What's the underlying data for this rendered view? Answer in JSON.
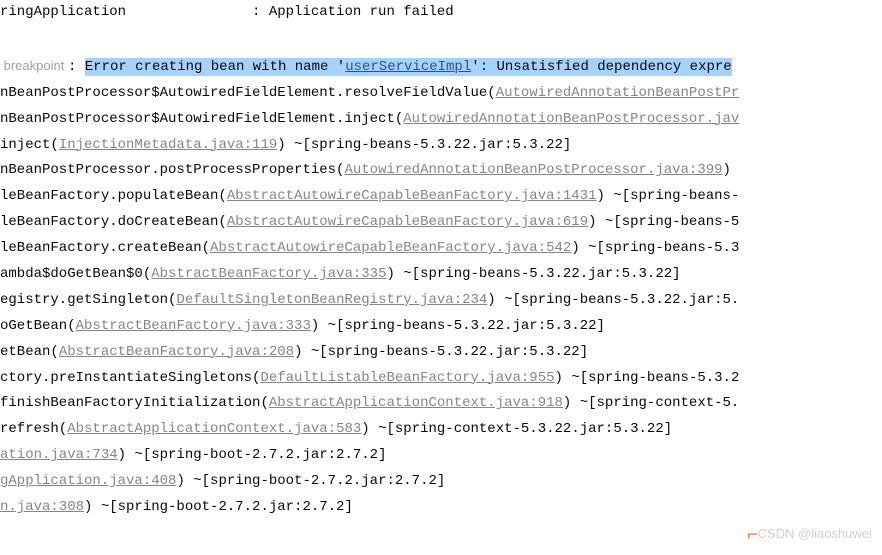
{
  "lines": {
    "l0": {
      "prefix": "ringApplication               : ",
      "msg": "Application run failed"
    },
    "breakpoint": {
      "label": " breakpoint ",
      "sep": ": ",
      "hl_before": "Error creating bean with name '",
      "bean": "userServiceImpl",
      "hl_after": "': Unsatisfied dependency expre"
    },
    "l2": {
      "t1": "nBeanPostProcessor$AutowiredFieldElement.resolveFieldValue(",
      "link": "AutowiredAnnotationBeanPostPr"
    },
    "l3": {
      "t1": "nBeanPostProcessor$AutowiredFieldElement.inject(",
      "link": "AutowiredAnnotationBeanPostProcessor.jav"
    },
    "l4": {
      "t1": "inject(",
      "link": "InjectionMetadata.java:119",
      "t2": ") ~[spring-beans-5.3.22.jar:5.3.22]"
    },
    "l5": {
      "t1": "nBeanPostProcessor.postProcessProperties(",
      "link": "AutowiredAnnotationBeanPostProcessor.java:399",
      "t2": ")"
    },
    "l6": {
      "t1": "leBeanFactory.populateBean(",
      "link": "AbstractAutowireCapableBeanFactory.java:1431",
      "t2": ") ~[spring-beans-"
    },
    "l7": {
      "t1": "leBeanFactory.doCreateBean(",
      "link": "AbstractAutowireCapableBeanFactory.java:619",
      "t2": ") ~[spring-beans-5"
    },
    "l8": {
      "t1": "leBeanFactory.createBean(",
      "link": "AbstractAutowireCapableBeanFactory.java:542",
      "t2": ") ~[spring-beans-5.3"
    },
    "l9": {
      "t1": "ambda$doGetBean$0(",
      "link": "AbstractBeanFactory.java:335",
      "t2": ") ~[spring-beans-5.3.22.jar:5.3.22]"
    },
    "l10": {
      "t1": "egistry.getSingleton(",
      "link": "DefaultSingletonBeanRegistry.java:234",
      "t2": ") ~[spring-beans-5.3.22.jar:5."
    },
    "l11": {
      "t1": "oGetBean(",
      "link": "AbstractBeanFactory.java:333",
      "t2": ") ~[spring-beans-5.3.22.jar:5.3.22]"
    },
    "l12": {
      "t1": "etBean(",
      "link": "AbstractBeanFactory.java:208",
      "t2": ") ~[spring-beans-5.3.22.jar:5.3.22]"
    },
    "l13": {
      "t1": "ctory.preInstantiateSingletons(",
      "link": "DefaultListableBeanFactory.java:955",
      "t2": ") ~[spring-beans-5.3.2"
    },
    "l14": {
      "t1": "finishBeanFactoryInitialization(",
      "link": "AbstractApplicationContext.java:918",
      "t2": ") ~[spring-context-5."
    },
    "l15": {
      "t1": "refresh(",
      "link": "AbstractApplicationContext.java:583",
      "t2": ") ~[spring-context-5.3.22.jar:5.3.22]"
    },
    "l16": {
      "link": "ation.java:734",
      "t2": ") ~[spring-boot-2.7.2.jar:2.7.2]"
    },
    "l17": {
      "link": "gApplication.java:408",
      "t2": ") ~[spring-boot-2.7.2.jar:2.7.2]"
    },
    "l18": {
      "link": "n.java:308",
      "t2": ") ~[spring-boot-2.7.2.jar:2.7.2]"
    }
  },
  "watermark": "CSDN @liaoshuwei"
}
